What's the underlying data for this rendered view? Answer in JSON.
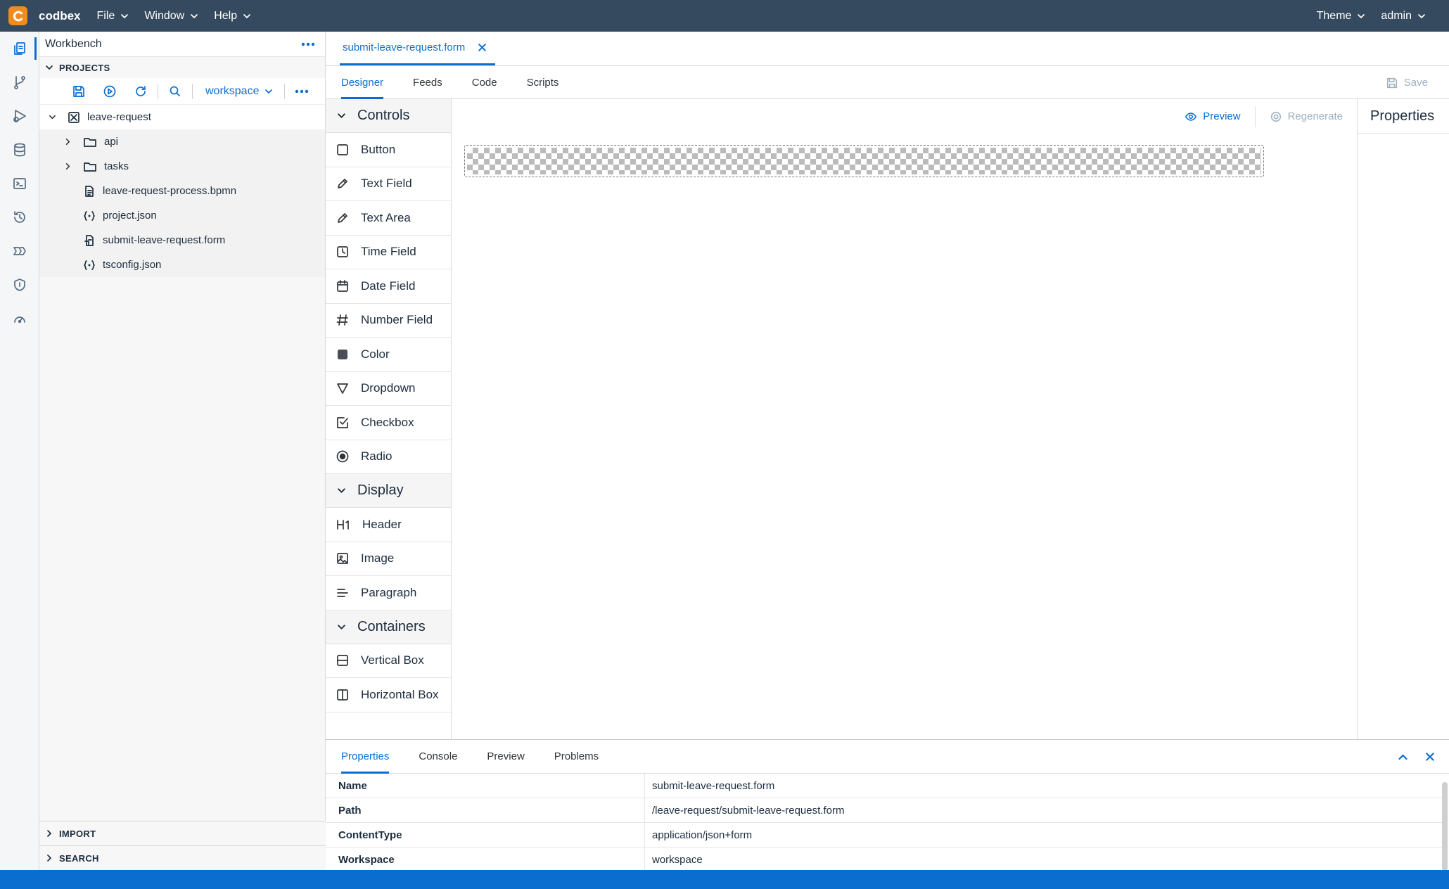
{
  "app": {
    "brand": "codbex",
    "menus": [
      "File",
      "Window",
      "Help"
    ],
    "right_menus": [
      "Theme",
      "admin"
    ]
  },
  "activity": {
    "items": [
      "projects-icon",
      "git-branch-icon",
      "deploy-icon",
      "database-icon",
      "terminal-icon",
      "history-icon",
      "pipeline-icon",
      "security-shield-icon",
      "gauge-icon"
    ]
  },
  "sidebar": {
    "title": "Workbench",
    "projects_label": "PROJECTS",
    "workspace": "workspace",
    "tree": [
      {
        "label": "leave-request",
        "level": 0,
        "type": "project"
      },
      {
        "label": "api",
        "level": 1,
        "type": "folder"
      },
      {
        "label": "tasks",
        "level": 1,
        "type": "folder"
      },
      {
        "label": "leave-request-process.bpmn",
        "level": 1,
        "type": "file"
      },
      {
        "label": "project.json",
        "level": 1,
        "type": "json"
      },
      {
        "label": "submit-leave-request.form",
        "level": 1,
        "type": "form"
      },
      {
        "label": "tsconfig.json",
        "level": 1,
        "type": "json"
      }
    ],
    "import_label": "IMPORT",
    "search_label": "SEARCH"
  },
  "editor": {
    "file_tab": "submit-leave-request.form",
    "subtabs": [
      "Designer",
      "Feeds",
      "Code",
      "Scripts"
    ],
    "save_label": "Save",
    "preview_label": "Preview",
    "regenerate_label": "Regenerate",
    "properties_title": "Properties",
    "palette": {
      "controls_label": "Controls",
      "controls": [
        "Button",
        "Text Field",
        "Text Area",
        "Time Field",
        "Date Field",
        "Number Field",
        "Color",
        "Dropdown",
        "Checkbox",
        "Radio"
      ],
      "display_label": "Display",
      "display": [
        "Header",
        "Image",
        "Paragraph"
      ],
      "containers_label": "Containers",
      "containers": [
        "Vertical Box",
        "Horizontal Box"
      ]
    }
  },
  "bottom": {
    "tabs": [
      "Properties",
      "Console",
      "Preview",
      "Problems"
    ],
    "rows": [
      {
        "k": "Name",
        "v": "submit-leave-request.form"
      },
      {
        "k": "Path",
        "v": "/leave-request/submit-leave-request.form"
      },
      {
        "k": "ContentType",
        "v": "application/json+form"
      },
      {
        "k": "Workspace",
        "v": "workspace"
      }
    ]
  },
  "colors": {
    "topbar": "#354a5f",
    "accent": "#0a6ed1",
    "logo": "#f28b1e",
    "statusbar": "#0a6ed1"
  }
}
